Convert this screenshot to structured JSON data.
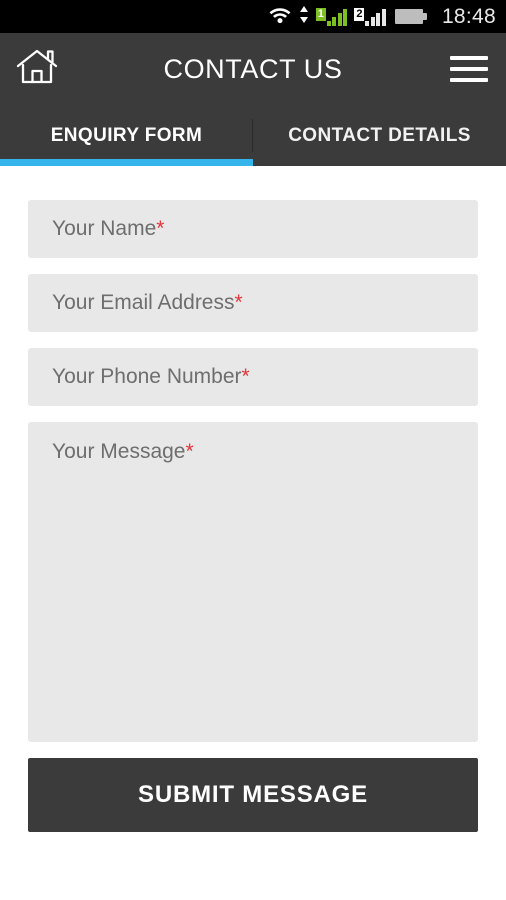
{
  "status_bar": {
    "time": "18:48",
    "wifi_icon": "wifi-icon",
    "data_transfer_icon": "up-down-arrows-icon",
    "sim1_label": "1",
    "sim2_label": "2",
    "battery_icon": "battery-icon",
    "colors": {
      "sim1_signal": "#7cc024",
      "sim2_signal": "#e8e8e8",
      "background": "#000000"
    }
  },
  "header": {
    "home_icon": "home-icon",
    "title": "CONTACT US",
    "menu_icon": "hamburger-menu-icon",
    "background": "#3b3b3b"
  },
  "tabs": {
    "active_index": 0,
    "accent_color": "#36b5ec",
    "items": [
      {
        "label": "ENQUIRY FORM"
      },
      {
        "label": "CONTACT DETAILS"
      }
    ]
  },
  "form": {
    "required_marker": "*",
    "required_color": "#e8333a",
    "field_background": "#e8e8e8",
    "fields": [
      {
        "name": "your-name",
        "placeholder": "Your Name",
        "value": "",
        "required": true,
        "type": "text"
      },
      {
        "name": "your-email",
        "placeholder": "Your Email Address",
        "value": "",
        "required": true,
        "type": "email"
      },
      {
        "name": "your-phone",
        "placeholder": "Your Phone Number",
        "value": "",
        "required": true,
        "type": "tel"
      },
      {
        "name": "your-message",
        "placeholder": "Your Message",
        "value": "",
        "required": true,
        "type": "textarea"
      }
    ],
    "submit_label": "SUBMIT MESSAGE"
  }
}
